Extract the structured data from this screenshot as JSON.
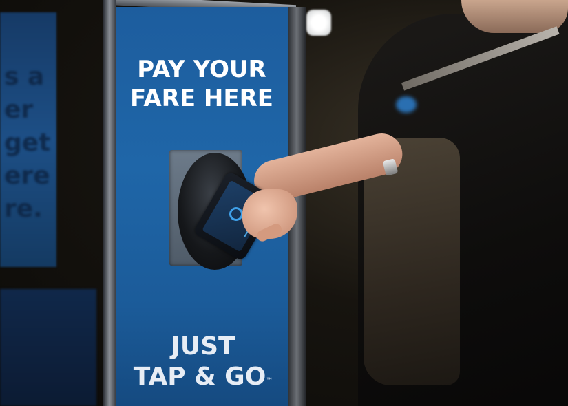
{
  "scene": {
    "description_free": true,
    "panel": {
      "headline_lines": [
        "PAY YOUR",
        "FARE HERE"
      ],
      "tagline_line1": "JUST",
      "tagline_line2": "TAP & GO",
      "trademark": "™"
    },
    "background_poster": {
      "text": "s a\ner\nget\nere\nre."
    },
    "colors": {
      "panel_blue": "#1f66a8",
      "text_white": "#ffffff",
      "phone_accent": "#3fa0e8"
    }
  }
}
